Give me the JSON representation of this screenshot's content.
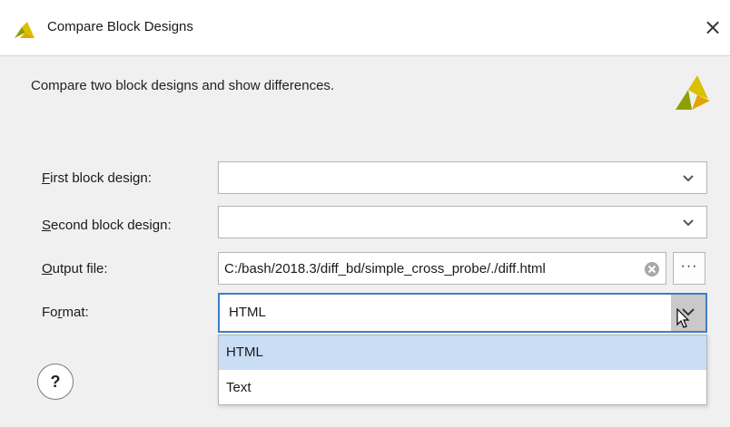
{
  "window": {
    "title": "Compare Block Designs",
    "close_glyph": "×",
    "logo_icon": "vivado-logo-icon"
  },
  "description": "Compare two block designs and show differences.",
  "form": {
    "first_block_design": {
      "label_mnemonic": "F",
      "label_rest": "irst block design:",
      "value": ""
    },
    "second_block_design": {
      "label_mnemonic": "S",
      "label_rest": "econd block design:",
      "value": ""
    },
    "output_file": {
      "label_mnemonic": "O",
      "label_rest": "utput file:",
      "value": "C:/bash/2018.3/diff_bd/simple_cross_probe/./diff.html",
      "browse_label": "···"
    },
    "format": {
      "label_prefix": "Fo",
      "label_mnemonic": "r",
      "label_rest": "mat:",
      "value": "HTML",
      "options": [
        "HTML",
        "Text"
      ],
      "highlighted_option": "HTML"
    }
  },
  "help": {
    "label": "?"
  },
  "colors": {
    "accent": "#3c7fc8",
    "highlight": "#c9ddf5",
    "logo_green": "#8ea000",
    "logo_yellow": "#d8c100"
  }
}
